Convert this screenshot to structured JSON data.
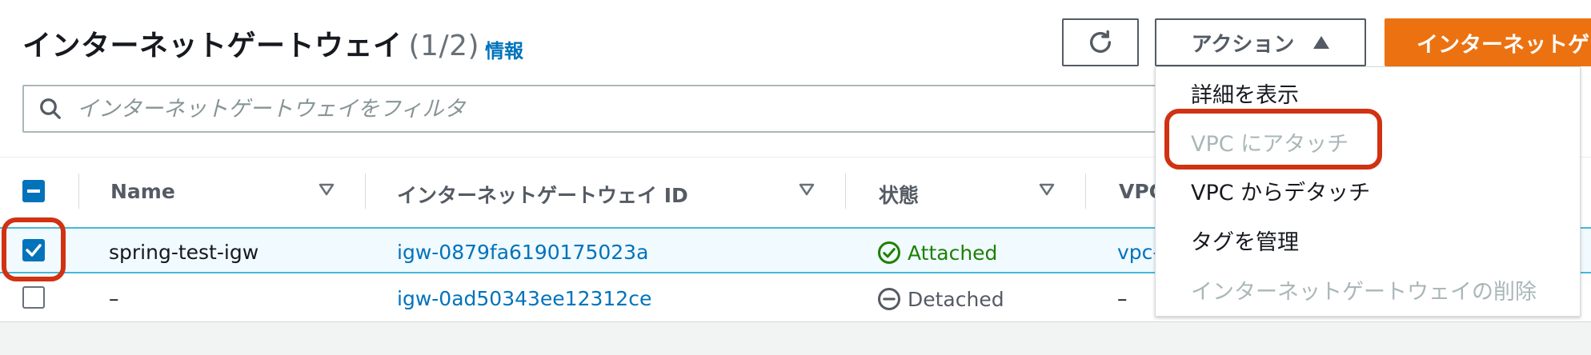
{
  "page": {
    "title": "インターネットゲートウェイ",
    "count": "(1/2)",
    "info_link": "情報"
  },
  "toolbar": {
    "actions_label": "アクション",
    "create_label": "インターネットゲートウェイの作成"
  },
  "filter": {
    "placeholder": "インターネットゲートウェイをフィルタ"
  },
  "table": {
    "columns": [
      "Name",
      "インターネットゲートウェイ ID",
      "状態",
      "VPC"
    ],
    "rows": [
      {
        "selected": true,
        "name": "spring-test-igw",
        "id": "igw-0879fa6190175023a",
        "state": "Attached",
        "vpc": "vpc-"
      },
      {
        "selected": false,
        "name": "–",
        "id": "igw-0ad50343ee12312ce",
        "state": "Detached",
        "vpc": "–"
      }
    ]
  },
  "actions_menu": {
    "items": [
      {
        "label": "詳細を表示",
        "enabled": true
      },
      {
        "label": "VPC にアタッチ",
        "enabled": false
      },
      {
        "label": "VPC からデタッチ",
        "enabled": true
      },
      {
        "label": "タグを管理",
        "enabled": true
      },
      {
        "label": "インターネットゲートウェイの削除",
        "enabled": false
      }
    ]
  },
  "colors": {
    "link": "#0073bb",
    "primary": "#ec7211",
    "attached": "#1d8102",
    "annotation": "#d13212",
    "selection_border": "#44b9d6"
  },
  "icons": [
    "refresh-icon",
    "caret-up-icon",
    "search-icon",
    "sort-icon",
    "check-circle-icon",
    "minus-circle-icon",
    "checkmark-icon"
  ]
}
